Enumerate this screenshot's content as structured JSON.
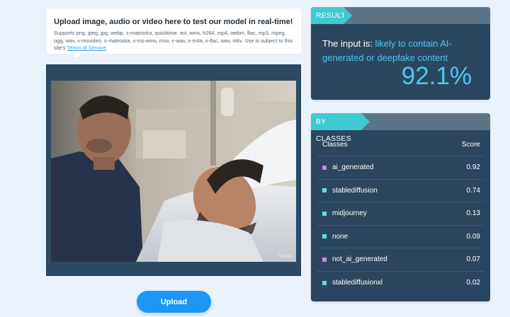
{
  "upload_card": {
    "title": "Upload image, audio or video here to test our model in real-time!",
    "supports_text": "Supports png, jpeg, jpg, webp, x-matroska, quicktime, avi, wmv, h264, mp4, webm, flac, mp3, mpeg, ogg, wav, x-msvideo, x-matroska, x-ms-wmv, mov, x-wav, x-m4a, x-flac, wav, mkv. Use is subject to this site's ",
    "tos_link": "Terms of Service",
    "tos_suffix": "."
  },
  "media": {
    "watermark": "SORA",
    "watermark_colour": "#ffffff"
  },
  "upload_button": {
    "label": "Upload"
  },
  "result": {
    "tag": "RESULT",
    "prefix": "The input is: ",
    "verdict": "likely to contain AI-generated or deepfake content",
    "score": "92.1%"
  },
  "classes": {
    "tag": "BY CLASSES",
    "col_class": "Classes",
    "col_score": "Score",
    "rows": [
      {
        "name": "ai_generated",
        "score": "0.92",
        "color": "#c98ae6"
      },
      {
        "name": "stablediffusion",
        "score": "0.74",
        "color": "#5ee0e8"
      },
      {
        "name": "midjourney",
        "score": "0.13",
        "color": "#5ee0e8"
      },
      {
        "name": "none",
        "score": "0.09",
        "color": "#5ee0e8"
      },
      {
        "name": "not_ai_generated",
        "score": "0.07",
        "color": "#c98ae6"
      },
      {
        "name": "stablediffusionxl",
        "score": "0.02",
        "color": "#5ee0e8"
      }
    ]
  },
  "colors": {
    "accent": "#41c9d1",
    "highlight": "#4cc6f4",
    "panel": "#2b475f",
    "button": "#1e96f5"
  }
}
